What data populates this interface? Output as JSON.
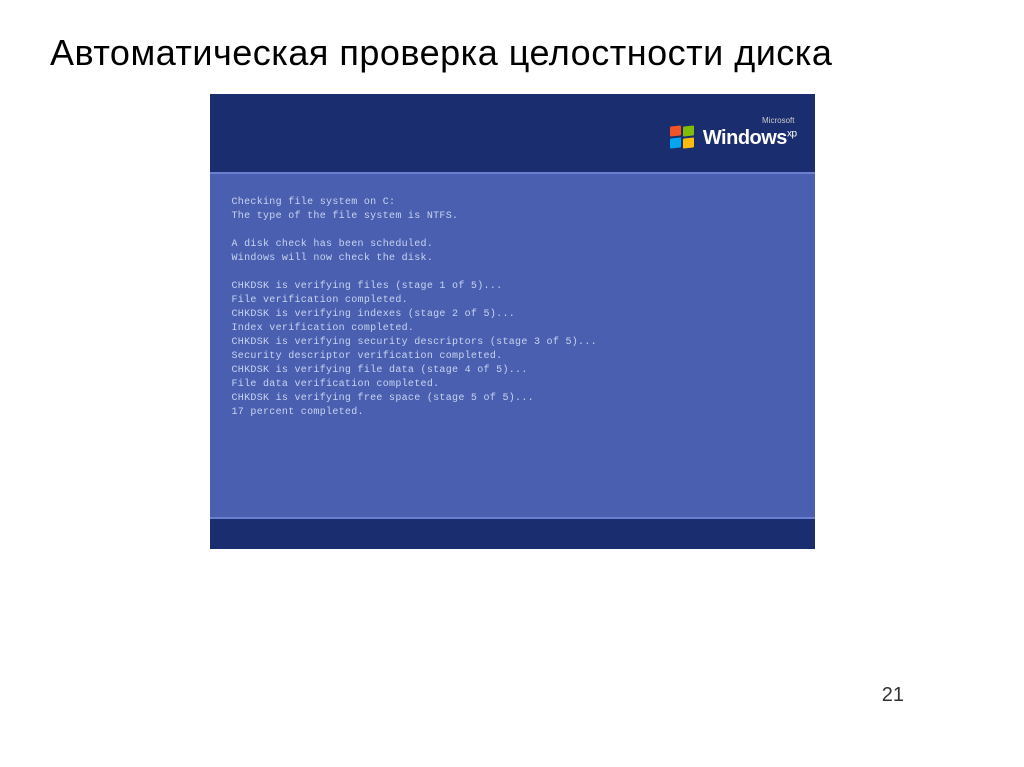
{
  "slide": {
    "title": "Автоматическая проверка целостности диска",
    "page_number": "21"
  },
  "windows_branding": {
    "microsoft": "Microsoft",
    "product": "Windows",
    "suffix": "xp"
  },
  "console": {
    "lines": [
      "Checking file system on C:",
      "The type of the file system is NTFS.",
      "",
      "A disk check has been scheduled.",
      "Windows will now check the disk.",
      "",
      "CHKDSK is verifying files (stage 1 of 5)...",
      "File verification completed.",
      "CHKDSK is verifying indexes (stage 2 of 5)...",
      "Index verification completed.",
      "CHKDSK is verifying security descriptors (stage 3 of 5)...",
      "Security descriptor verification completed.",
      "CHKDSK is verifying file data (stage 4 of 5)...",
      "File data verification completed.",
      "CHKDSK is verifying free space (stage 5 of 5)...",
      "17 percent completed."
    ]
  }
}
